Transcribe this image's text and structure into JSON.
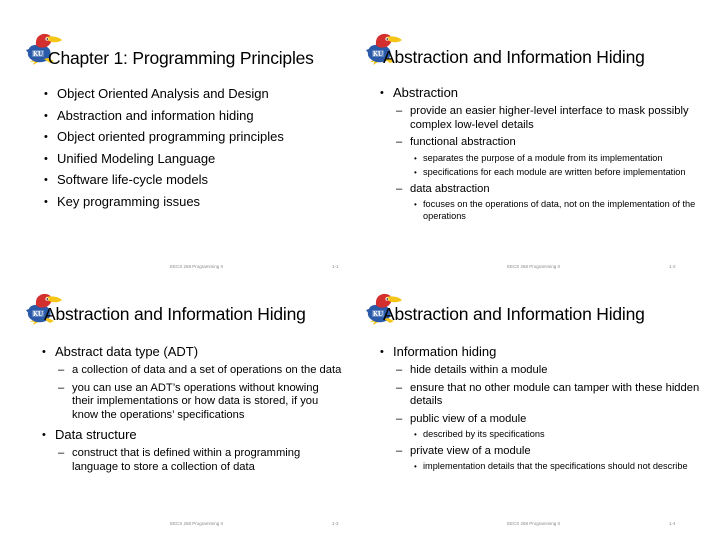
{
  "footer_text": "EECS 268 Programming II",
  "logo": {
    "icon": "jayhawk-logo-icon",
    "label": "KU",
    "colors": {
      "blue": "#2a5aa8",
      "red": "#d32f2f",
      "yellow": "#f5c518"
    }
  },
  "slides": [
    {
      "title": "Chapter 1: Programming Principles",
      "page": "1-1",
      "bullets": [
        {
          "text": "Object Oriented Analysis and Design"
        },
        {
          "text": "Abstraction and information hiding"
        },
        {
          "text": "Object oriented programming principles"
        },
        {
          "text": "Unified Modeling Language"
        },
        {
          "text": "Software life-cycle models"
        },
        {
          "text": "Key programming issues"
        }
      ]
    },
    {
      "title": "Abstraction and Information Hiding",
      "page": "1-2",
      "bullets": [
        {
          "text": "Abstraction",
          "sub": [
            {
              "text": "provide an easier higher-level interface to mask possibly complex low-level details"
            },
            {
              "text": "functional abstraction",
              "sub": [
                {
                  "text": "separates the purpose of a module from its implementation"
                },
                {
                  "text": "specifications for each module are written before implementation"
                }
              ]
            },
            {
              "text": "data abstraction",
              "sub": [
                {
                  "text": "focuses on the operations of data, not on the implementation of the operations"
                }
              ]
            }
          ]
        }
      ]
    },
    {
      "title": "Abstraction and Information Hiding",
      "page": "1-3",
      "bullets": [
        {
          "text": "Abstract data type (ADT)",
          "sub": [
            {
              "text": "a collection of data and a set of operations on the data"
            },
            {
              "text": "you can use an ADT’s operations without knowing their implementations or how data is stored, if you know the operations’ specifications"
            }
          ]
        },
        {
          "text": "Data structure",
          "sub": [
            {
              "text": "construct that is defined within a programming language to store a collection of data"
            }
          ]
        }
      ]
    },
    {
      "title": "Abstraction and Information Hiding",
      "page": "1-4",
      "bullets": [
        {
          "text": "Information hiding",
          "sub": [
            {
              "text": "hide details within a module"
            },
            {
              "text": "ensure that no other module can tamper with these hidden details"
            },
            {
              "text": "public view of a module",
              "sub": [
                {
                  "text": "described by its specifications"
                }
              ]
            },
            {
              "text": "private view of a module",
              "sub": [
                {
                  "text": "implementation details that the specifications should not describe"
                }
              ]
            }
          ]
        }
      ]
    }
  ]
}
